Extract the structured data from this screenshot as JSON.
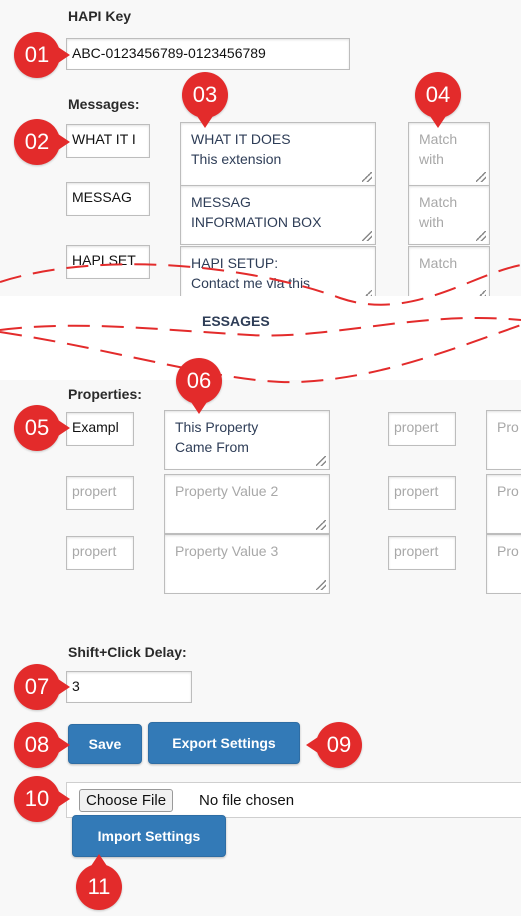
{
  "hapi_key": {
    "label": "HAPI Key",
    "value": "ABC-0123456789-0123456789"
  },
  "messages": {
    "label": "Messages:",
    "rows": [
      {
        "name": "WHAT IT I",
        "text_line1": "WHAT IT DOES",
        "text_line2": "This extension",
        "match_line1": "Match",
        "match_line2": "with"
      },
      {
        "name": "MESSAG",
        "text_line1": "MESSAG",
        "text_line2": "INFORMATION BOX",
        "match_line1": "Match",
        "match_line2": "with"
      },
      {
        "name": "HAPI SET",
        "text_line1": "HAPI SETUP:",
        "text_line2": "Contact me via this",
        "match_line1": "Match",
        "match_line2": ""
      }
    ],
    "partial_row_text": "ESSAGES"
  },
  "properties": {
    "label": "Properties:",
    "rows": [
      {
        "name": "Exampl",
        "value_line1": "This Property",
        "value_line2": "Came From",
        "value_placeholder": false,
        "name2": "propert",
        "value2": "Pro"
      },
      {
        "name": "propert",
        "value_line1": "Property Value 2",
        "value_line2": "",
        "value_placeholder": true,
        "name2": "propert",
        "value2": "Pro"
      },
      {
        "name": "propert",
        "value_line1": "Property Value 3",
        "value_line2": "",
        "value_placeholder": true,
        "name2": "propert",
        "value2": "Pro"
      }
    ]
  },
  "delay": {
    "label": "Shift+Click Delay:",
    "value": "3"
  },
  "buttons": {
    "save": "Save",
    "export": "Export Settings",
    "import": "Import Settings"
  },
  "file": {
    "choose": "Choose File",
    "status": "No file chosen"
  },
  "badges": [
    "01",
    "02",
    "03",
    "04",
    "05",
    "06",
    "07",
    "08",
    "09",
    "10",
    "11"
  ],
  "colors": {
    "badge": "#e32b2b",
    "button": "#337ab7"
  }
}
